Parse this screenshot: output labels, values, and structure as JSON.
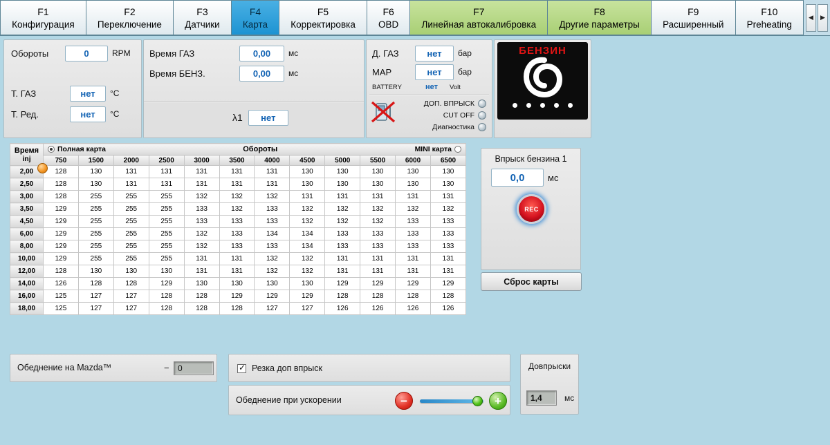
{
  "tabs": [
    {
      "fkey": "F1",
      "label": "Конфигурация",
      "state": "normal"
    },
    {
      "fkey": "F2",
      "label": "Переключение",
      "state": "normal"
    },
    {
      "fkey": "F3",
      "label": "Датчики",
      "state": "normal"
    },
    {
      "fkey": "F4",
      "label": "Карта",
      "state": "active"
    },
    {
      "fkey": "F5",
      "label": "Корректировка",
      "state": "normal"
    },
    {
      "fkey": "F6",
      "label": "OBD",
      "state": "normal"
    },
    {
      "fkey": "F7",
      "label": "Линейная автокалибровка",
      "state": "green"
    },
    {
      "fkey": "F8",
      "label": "Другие параметры",
      "state": "green"
    },
    {
      "fkey": "F9",
      "label": "Расширенный",
      "state": "normal"
    },
    {
      "fkey": "F10",
      "label": "Preheating",
      "state": "normal"
    }
  ],
  "tab_arrows": {
    "left": "◀",
    "right": "▶"
  },
  "status": {
    "rpm": {
      "label": "Обороты",
      "value": "0",
      "unit": "RPM"
    },
    "t_gas": {
      "label": "Т. ГАЗ",
      "value": "нет",
      "unit": "°C"
    },
    "t_red": {
      "label": "Т. Ред.",
      "value": "нет",
      "unit": "°C"
    },
    "time_gas": {
      "label": "Время ГАЗ",
      "value": "0,00",
      "unit": "мс"
    },
    "time_benz": {
      "label": "Время БЕНЗ.",
      "value": "0,00",
      "unit": "мс"
    },
    "lambda": {
      "label": "λ1",
      "value": "нет"
    },
    "d_gas": {
      "label": "Д. ГАЗ",
      "value": "нет",
      "unit": "бар"
    },
    "map_sensor": {
      "label": "MAP",
      "value": "нет",
      "unit": "бар"
    },
    "battery": {
      "label": "BATTERY",
      "value": "нет",
      "unit": "Volt"
    },
    "indicators": [
      {
        "label": "ДОП. ВПРЫСК"
      },
      {
        "label": "CUT OFF"
      },
      {
        "label": "Диагностика"
      }
    ],
    "fuel_mode": "БЕНЗИН"
  },
  "map_table": {
    "corner_top": "Время",
    "corner_bottom": "inj",
    "full_map": "Полная карта",
    "rpm_header": "Обороты",
    "mini_map": "MINI карта",
    "columns": [
      "750",
      "1500",
      "2000",
      "2500",
      "3000",
      "3500",
      "4000",
      "4500",
      "5000",
      "5500",
      "6000",
      "6500"
    ],
    "rows": [
      {
        "time": "2,00",
        "values": [
          128,
          130,
          131,
          131,
          131,
          131,
          131,
          130,
          130,
          130,
          130,
          130
        ]
      },
      {
        "time": "2,50",
        "values": [
          128,
          130,
          131,
          131,
          131,
          131,
          131,
          130,
          130,
          130,
          130,
          130
        ]
      },
      {
        "time": "3,00",
        "values": [
          128,
          255,
          255,
          255,
          132,
          132,
          132,
          131,
          131,
          131,
          131,
          131
        ]
      },
      {
        "time": "3,50",
        "values": [
          129,
          255,
          255,
          255,
          133,
          132,
          133,
          132,
          132,
          132,
          132,
          132
        ]
      },
      {
        "time": "4,50",
        "values": [
          129,
          255,
          255,
          255,
          133,
          133,
          133,
          132,
          132,
          132,
          133,
          133
        ]
      },
      {
        "time": "6,00",
        "values": [
          129,
          255,
          255,
          255,
          132,
          133,
          134,
          134,
          133,
          133,
          133,
          133
        ]
      },
      {
        "time": "8,00",
        "values": [
          129,
          255,
          255,
          255,
          132,
          133,
          133,
          134,
          133,
          133,
          133,
          133
        ]
      },
      {
        "time": "10,00",
        "values": [
          129,
          255,
          255,
          255,
          131,
          131,
          132,
          132,
          131,
          131,
          131,
          131
        ]
      },
      {
        "time": "12,00",
        "values": [
          128,
          130,
          130,
          130,
          131,
          131,
          132,
          132,
          131,
          131,
          131,
          131
        ]
      },
      {
        "time": "14,00",
        "values": [
          126,
          128,
          128,
          129,
          130,
          130,
          130,
          130,
          129,
          129,
          129,
          129
        ]
      },
      {
        "time": "16,00",
        "values": [
          125,
          127,
          127,
          128,
          128,
          129,
          129,
          129,
          128,
          128,
          128,
          128
        ]
      },
      {
        "time": "18,00",
        "values": [
          125,
          127,
          127,
          128,
          128,
          128,
          127,
          127,
          126,
          126,
          126,
          126
        ]
      }
    ]
  },
  "injection": {
    "title": "Впрыск бензина 1",
    "value": "0,0",
    "unit": "мс",
    "rec_label": "REC",
    "reset_label": "Сброс карты"
  },
  "bottom": {
    "mazda": {
      "label": "Обеднение на Mazda™",
      "minus": "−",
      "value": "0"
    },
    "cut_injection": {
      "label": "Резка доп впрыск",
      "checked": true
    },
    "accel_lean": {
      "label": "Обеднение при ускорении",
      "minus": "−",
      "plus": "+"
    },
    "extra_injection": {
      "label": "Довпрыски",
      "value": "1,4",
      "unit": "мс"
    }
  },
  "colors": {
    "value_blue": "#1464b4",
    "active_tab_blue": "#2da2e0",
    "green_tab": "#b9da8e",
    "fuel_red": "#e01414"
  }
}
